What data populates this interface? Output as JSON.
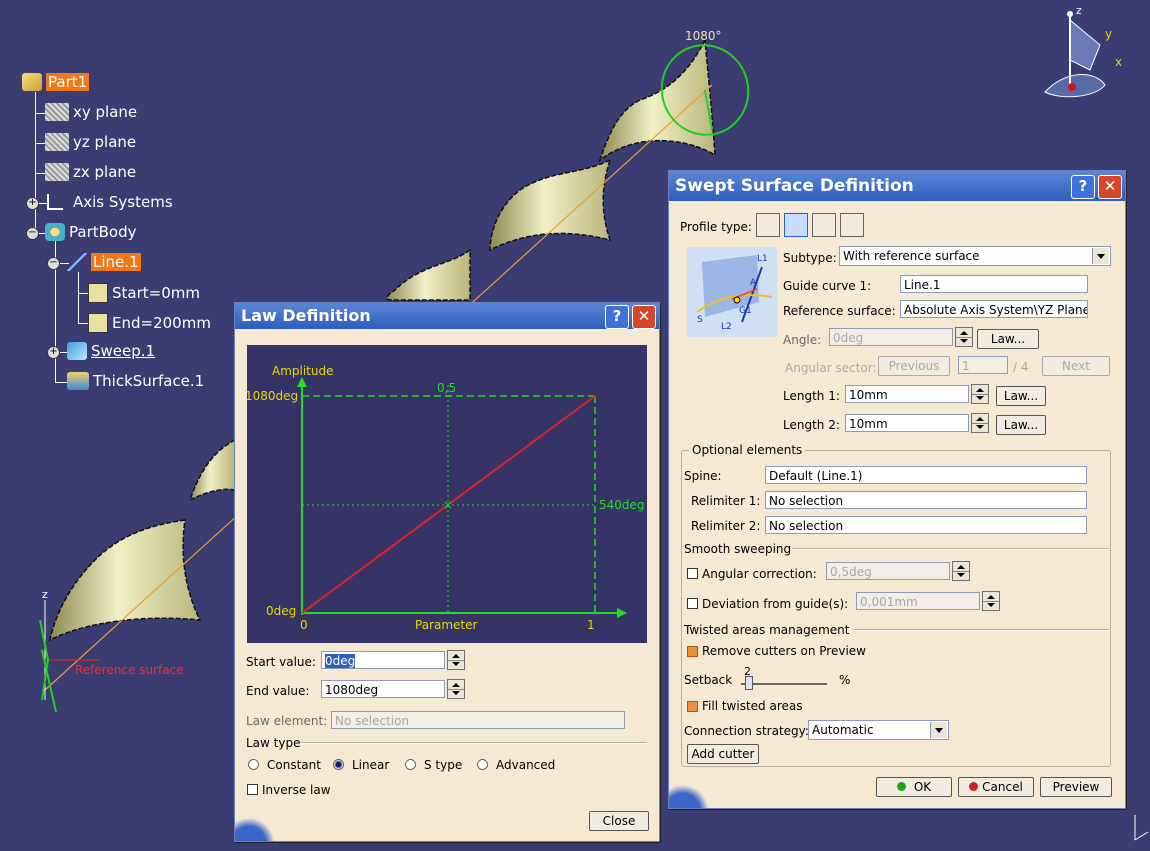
{
  "viewport": {
    "angle_label": "1080°",
    "ref_surface_label": "Reference surface",
    "compass": {
      "z": "z",
      "y": "y",
      "x": "x"
    }
  },
  "tree": {
    "root": "Part1",
    "items": [
      "xy plane",
      "yz plane",
      "zx plane",
      "Axis Systems",
      "PartBody",
      "Line.1",
      "Start=0mm",
      "End=200mm",
      "Sweep.1",
      "ThickSurface.1"
    ]
  },
  "law": {
    "title": "Law Definition",
    "graph": {
      "amplitude": "Amplitude",
      "y_top": "1080deg",
      "y_mid": "540deg",
      "y_zero": "0deg",
      "x_zero": "0",
      "x_mid": "0,5",
      "x_end": "1",
      "x_label": "Parameter"
    },
    "start_label": "Start value:",
    "start_value": "0deg",
    "end_label": "End value:",
    "end_value": "1080deg",
    "element_label": "Law element:",
    "element_value": "No selection",
    "type_label": "Law type",
    "types": [
      "Constant",
      "Linear",
      "S type",
      "Advanced"
    ],
    "inverse": "Inverse law",
    "close": "Close"
  },
  "swept": {
    "title": "Swept Surface Definition",
    "profile_type": "Profile type:",
    "subtype_label": "Subtype:",
    "subtype_value": "With reference surface",
    "guide_label": "Guide curve 1:",
    "guide_value": "Line.1",
    "ref_label": "Reference surface:",
    "ref_value": "Absolute Axis System\\YZ Plane",
    "angle_label": "Angle:",
    "angle_value": "0deg",
    "law_btn": "Law...",
    "sector_label": "Angular sector:",
    "previous": "Previous",
    "sector_value": "1",
    "sector_of": "/ 4",
    "next": "Next",
    "length1_label": "Length 1:",
    "length1_value": "10mm",
    "length2_label": "Length 2:",
    "length2_value": "10mm",
    "sketch_labels": {
      "l1": "L1",
      "a": "A",
      "g1": "G1",
      "s": "S",
      "l2": "L2"
    },
    "optional": "Optional elements",
    "spine_label": "Spine:",
    "spine_value": "Default (Line.1)",
    "relim1_label": "Relimiter 1:",
    "relim1_value": "No selection",
    "relim2_label": "Relimiter 2:",
    "relim2_value": "No selection",
    "smooth": "Smooth sweeping",
    "angular_corr": "Angular correction:",
    "angular_corr_value": "0,5deg",
    "deviation": "Deviation from guide(s):",
    "deviation_value": "0,001mm",
    "twisted": "Twisted areas management",
    "remove_cutters": "Remove cutters on Preview",
    "setback_label": "Setback",
    "setback_value": "2",
    "setback_unit": "%",
    "setback_fraction": 0.05,
    "fill_twisted": "Fill twisted areas",
    "conn_label": "Connection strategy:",
    "conn_value": "Automatic",
    "add_cutter": "Add cutter",
    "ok": "OK",
    "cancel": "Cancel",
    "preview": "Preview"
  },
  "colors": {
    "background": "#3a3c72",
    "dialog": "#f6e9d4",
    "titlebar": "#2f5dbb",
    "graph_bg": "#363366",
    "graph_green": "#22dd22",
    "graph_curve": "#dd2222",
    "graph_text": "#e8d800",
    "surface": "#e8e6b4",
    "tree_highlight": "#f07818"
  }
}
